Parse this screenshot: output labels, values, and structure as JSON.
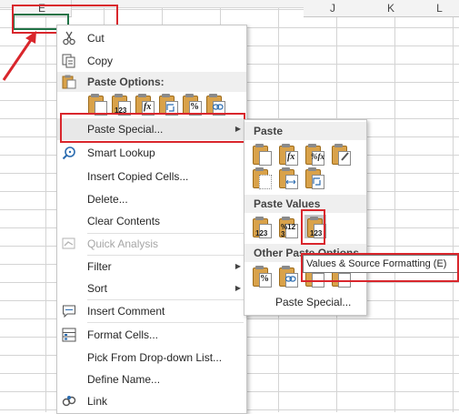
{
  "sheet": {
    "columns": [
      {
        "label": "E"
      },
      {
        "label": "J"
      },
      {
        "label": "K"
      },
      {
        "label": "L"
      }
    ]
  },
  "context_menu": {
    "items": [
      {
        "label": "Cut",
        "icon": "scissors-icon"
      },
      {
        "label": "Copy",
        "icon": "copy-icon"
      },
      {
        "label": "Paste Special...",
        "icon": "",
        "has_submenu": true
      },
      {
        "label": "Smart Lookup",
        "icon": "smart-lookup-icon"
      },
      {
        "label": "Insert Copied Cells...",
        "icon": ""
      },
      {
        "label": "Delete...",
        "icon": ""
      },
      {
        "label": "Clear Contents",
        "icon": ""
      },
      {
        "label": "Quick Analysis",
        "icon": "quick-analysis-icon",
        "disabled": true
      },
      {
        "label": "Filter",
        "icon": "",
        "has_submenu": true
      },
      {
        "label": "Sort",
        "icon": "",
        "has_submenu": true
      },
      {
        "label": "Insert Comment",
        "icon": "comment-icon"
      },
      {
        "label": "Format Cells...",
        "icon": "format-cells-icon"
      },
      {
        "label": "Pick From Drop-down List...",
        "icon": ""
      },
      {
        "label": "Define Name...",
        "icon": ""
      },
      {
        "label": "Link",
        "icon": "link-icon"
      }
    ],
    "paste_options_label": "Paste Options:",
    "paste_option_icons": [
      "paste-icon",
      "paste-values-icon",
      "paste-formulas-icon",
      "paste-transpose-icon",
      "paste-formatting-icon",
      "paste-link-icon"
    ],
    "paste_option_texts": [
      "",
      "123",
      "fx",
      "",
      "%",
      ""
    ]
  },
  "submenu": {
    "paste_label": "Paste",
    "paste_values_label": "Paste Values",
    "other_label": "Other Paste Options",
    "paste_special_label": "Paste Special...",
    "paste_texts": [
      "",
      "fx",
      "%fx",
      "",
      "",
      "",
      ""
    ],
    "values_texts": [
      "123",
      "%123",
      "123"
    ],
    "other_texts": [
      "%",
      "",
      "",
      ""
    ]
  },
  "tooltip": {
    "text": "Values & Source Formatting (E)"
  },
  "colors": {
    "highlight_red": "#d9262c",
    "excel_green": "#217346"
  }
}
